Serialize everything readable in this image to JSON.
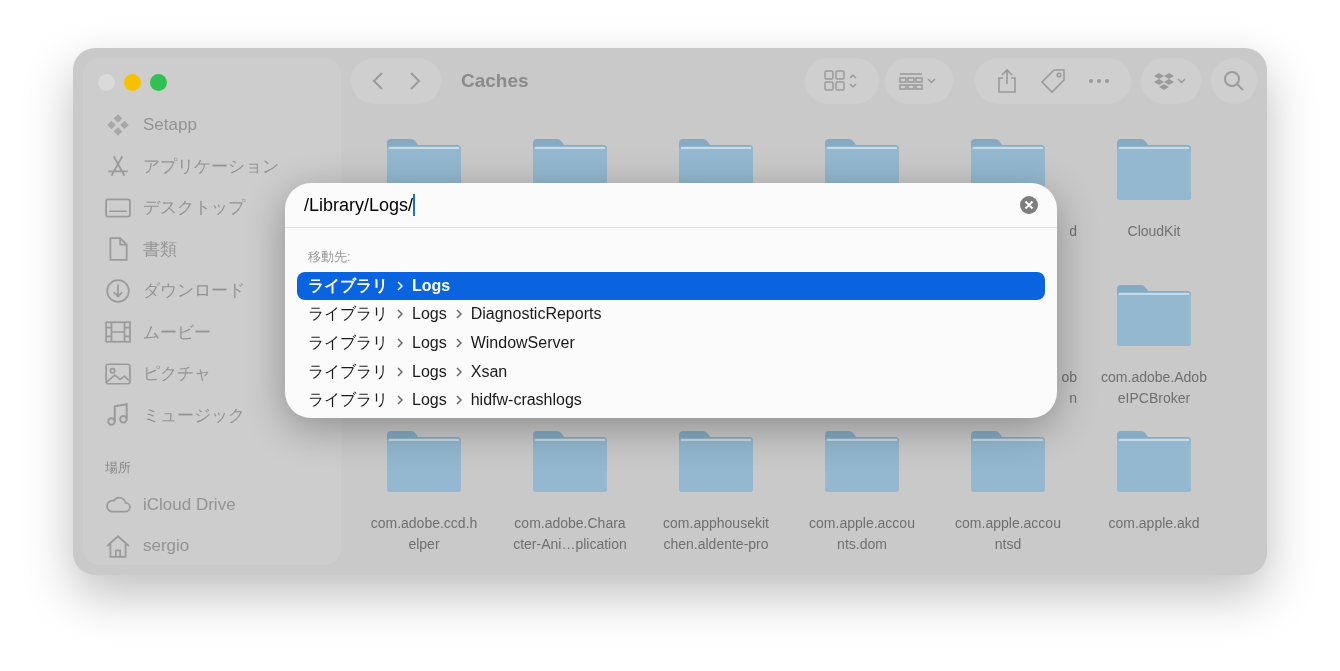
{
  "window": {
    "title": "Caches"
  },
  "sidebar": {
    "items": [
      {
        "kind": "item",
        "label": "Setapp"
      },
      {
        "kind": "item",
        "label": "アプリケーション"
      },
      {
        "kind": "item",
        "label": "デスクトップ"
      },
      {
        "kind": "item",
        "label": "書類"
      },
      {
        "kind": "item",
        "label": "ダウンロード"
      },
      {
        "kind": "item",
        "label": "ムービー"
      },
      {
        "kind": "item",
        "label": "ピクチャ"
      },
      {
        "kind": "item",
        "label": "ミュージック"
      },
      {
        "kind": "header",
        "label": "場所"
      },
      {
        "kind": "item",
        "label": "iCloud Drive"
      },
      {
        "kind": "item",
        "label": "sergio"
      }
    ]
  },
  "folders": [
    {
      "kind": "covered"
    },
    {
      "kind": "covered"
    },
    {
      "kind": "covered"
    },
    {
      "kind": "covered"
    },
    {
      "kind": "partial",
      "label": "d"
    },
    {
      "kind": "folder",
      "label": "CloudKit"
    },
    {
      "kind": "hidden"
    },
    {
      "kind": "hidden"
    },
    {
      "kind": "hidden"
    },
    {
      "kind": "hidden"
    },
    {
      "kind": "partial",
      "label": "ob\nn"
    },
    {
      "kind": "folder",
      "label": "com.adobe.Adob\neIPCBroker"
    },
    {
      "kind": "folder",
      "label": "com.adobe.ccd.h\nelper"
    },
    {
      "kind": "folder",
      "label": "com.adobe.Chara\ncter-Ani…plication"
    },
    {
      "kind": "folder",
      "label": "com.apphousekit\nchen.aldente-pro"
    },
    {
      "kind": "folder",
      "label": "com.apple.accou\nnts.dom"
    },
    {
      "kind": "folder",
      "label": "com.apple.accou\nntsd"
    },
    {
      "kind": "folder",
      "label": "com.apple.akd"
    }
  ],
  "go_to_folder": {
    "value": "/Library/Logs/",
    "section_label": "移動先:",
    "results": [
      {
        "segments": [
          "ライブラリ",
          "Logs"
        ],
        "selected": true
      },
      {
        "segments": [
          "ライブラリ",
          "Logs",
          "DiagnosticReports"
        ],
        "selected": false
      },
      {
        "segments": [
          "ライブラリ",
          "Logs",
          "WindowServer"
        ],
        "selected": false
      },
      {
        "segments": [
          "ライブラリ",
          "Logs",
          "Xsan"
        ],
        "selected": false
      },
      {
        "segments": [
          "ライブラリ",
          "Logs",
          "hidfw-crashlogs"
        ],
        "selected": false
      }
    ]
  }
}
